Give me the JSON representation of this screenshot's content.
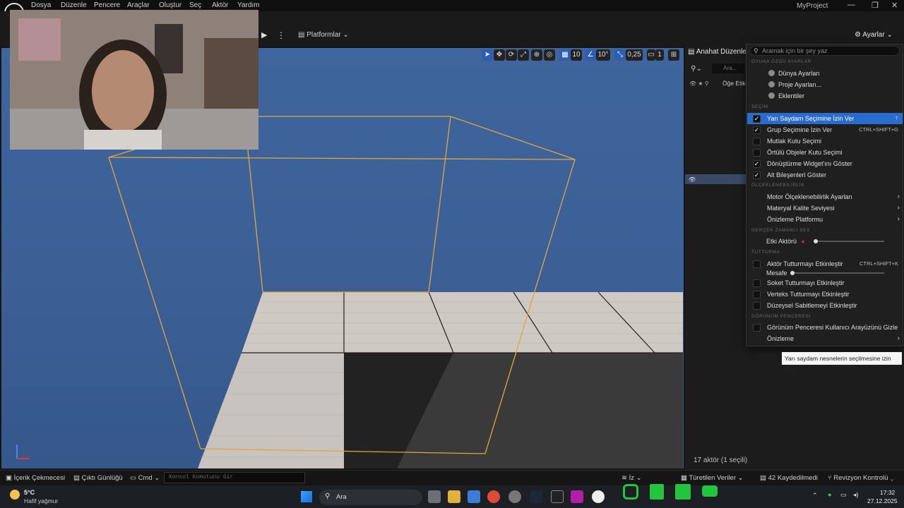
{
  "menu": {
    "items": [
      "Dosya",
      "Düzenle",
      "Pencere",
      "Araçlar",
      "Oluştur",
      "Seç",
      "Aktör",
      "Yardım"
    ],
    "project_title": "MyProject"
  },
  "toolbar": {
    "platforms_label": "Platformlar",
    "settings_label": "Ayarlar"
  },
  "viewport_toolbar": {
    "grid_snap": "10",
    "rotation_snap": "10°",
    "scale_snap": "0,25",
    "camera_speed": "1"
  },
  "outliner": {
    "tab_title": "Anahat Düzenle...",
    "search_placeholder": "Ara...",
    "column_label": "Öğe Etik",
    "footer": "17 aktör (1 seçili)"
  },
  "settings_menu": {
    "search_placeholder": "Aramak için bir şey yaz",
    "sections": {
      "level": "OYUNA ÖZGÜ AYARLAR",
      "selection": "SEÇİM",
      "scalability": "ÖLÇEKLENEBİLİRLİK",
      "realtime": "GERÇEK ZAMANLI SES",
      "snapping": "TUTTURMA",
      "viewport": "GÖRÜNÜM PENCERESİ"
    },
    "level_items": [
      "Dünya Ayarları",
      "Proje Ayarları...",
      "Eklentiler"
    ],
    "selection_items": [
      {
        "label": "Yarı Saydam Seçimine İzin Ver",
        "checked": true,
        "shortcut": "T",
        "highlighted": true
      },
      {
        "label": "Grup Seçimine İzin Ver",
        "checked": true,
        "shortcut": "CTRL+SHIFT+G"
      },
      {
        "label": "Mutlak Kutu Seçimi",
        "checked": false,
        "shortcut": ""
      },
      {
        "label": "Örtülü Objeler Kutu Seçimi",
        "checked": false,
        "shortcut": ""
      },
      {
        "label": "Dönüştürme Widget'ını Göster",
        "checked": true,
        "shortcut": ""
      },
      {
        "label": "Alt Bileşenleri Göster",
        "checked": true,
        "shortcut": ""
      }
    ],
    "scalability_items": [
      "Motor Ölçeklenebilirlik Ayarları",
      "Materyal Kalite Seviyesi",
      "Önizleme Platformu"
    ],
    "realtime_label": "Etki Aktörü",
    "snapping_items": [
      {
        "label": "Aktör Tutturmayı Etkinleştir",
        "shortcut": "CTRL+SHIFT+K"
      },
      {
        "label": "Soket Tutturmayı Etkinleştir",
        "shortcut": ""
      },
      {
        "label": "Verteks Tutturmayı Etkinleştir",
        "shortcut": ""
      },
      {
        "label": "Düzeysel Sabitlemeyi Etkinleştir",
        "shortcut": ""
      }
    ],
    "distance_label": "Mesafe",
    "viewport_items": [
      "Görünüm Penceresi Kullanıcı Arayüzünü Gizle",
      "Önizleme"
    ]
  },
  "tooltip": "Yarı saydam nesnelerin seçilmesine izin verir.",
  "bottom_bar": {
    "content_drawer": "İçerik Çekmecesi",
    "output_log": "Çıktı Günlüğü",
    "cmd": "Cmd",
    "console_placeholder": "Konsol Komutunu Gir",
    "derived_data": "Türetilen Veriler",
    "unsaved": "42 Kaydedilmedi",
    "revision": "Revizyon Kontrolü"
  },
  "taskbar": {
    "weather_temp": "5°C",
    "weather_desc": "Hafif yağmur",
    "search_label": "Ara",
    "time": "17:32",
    "date": "27.12.2025"
  }
}
